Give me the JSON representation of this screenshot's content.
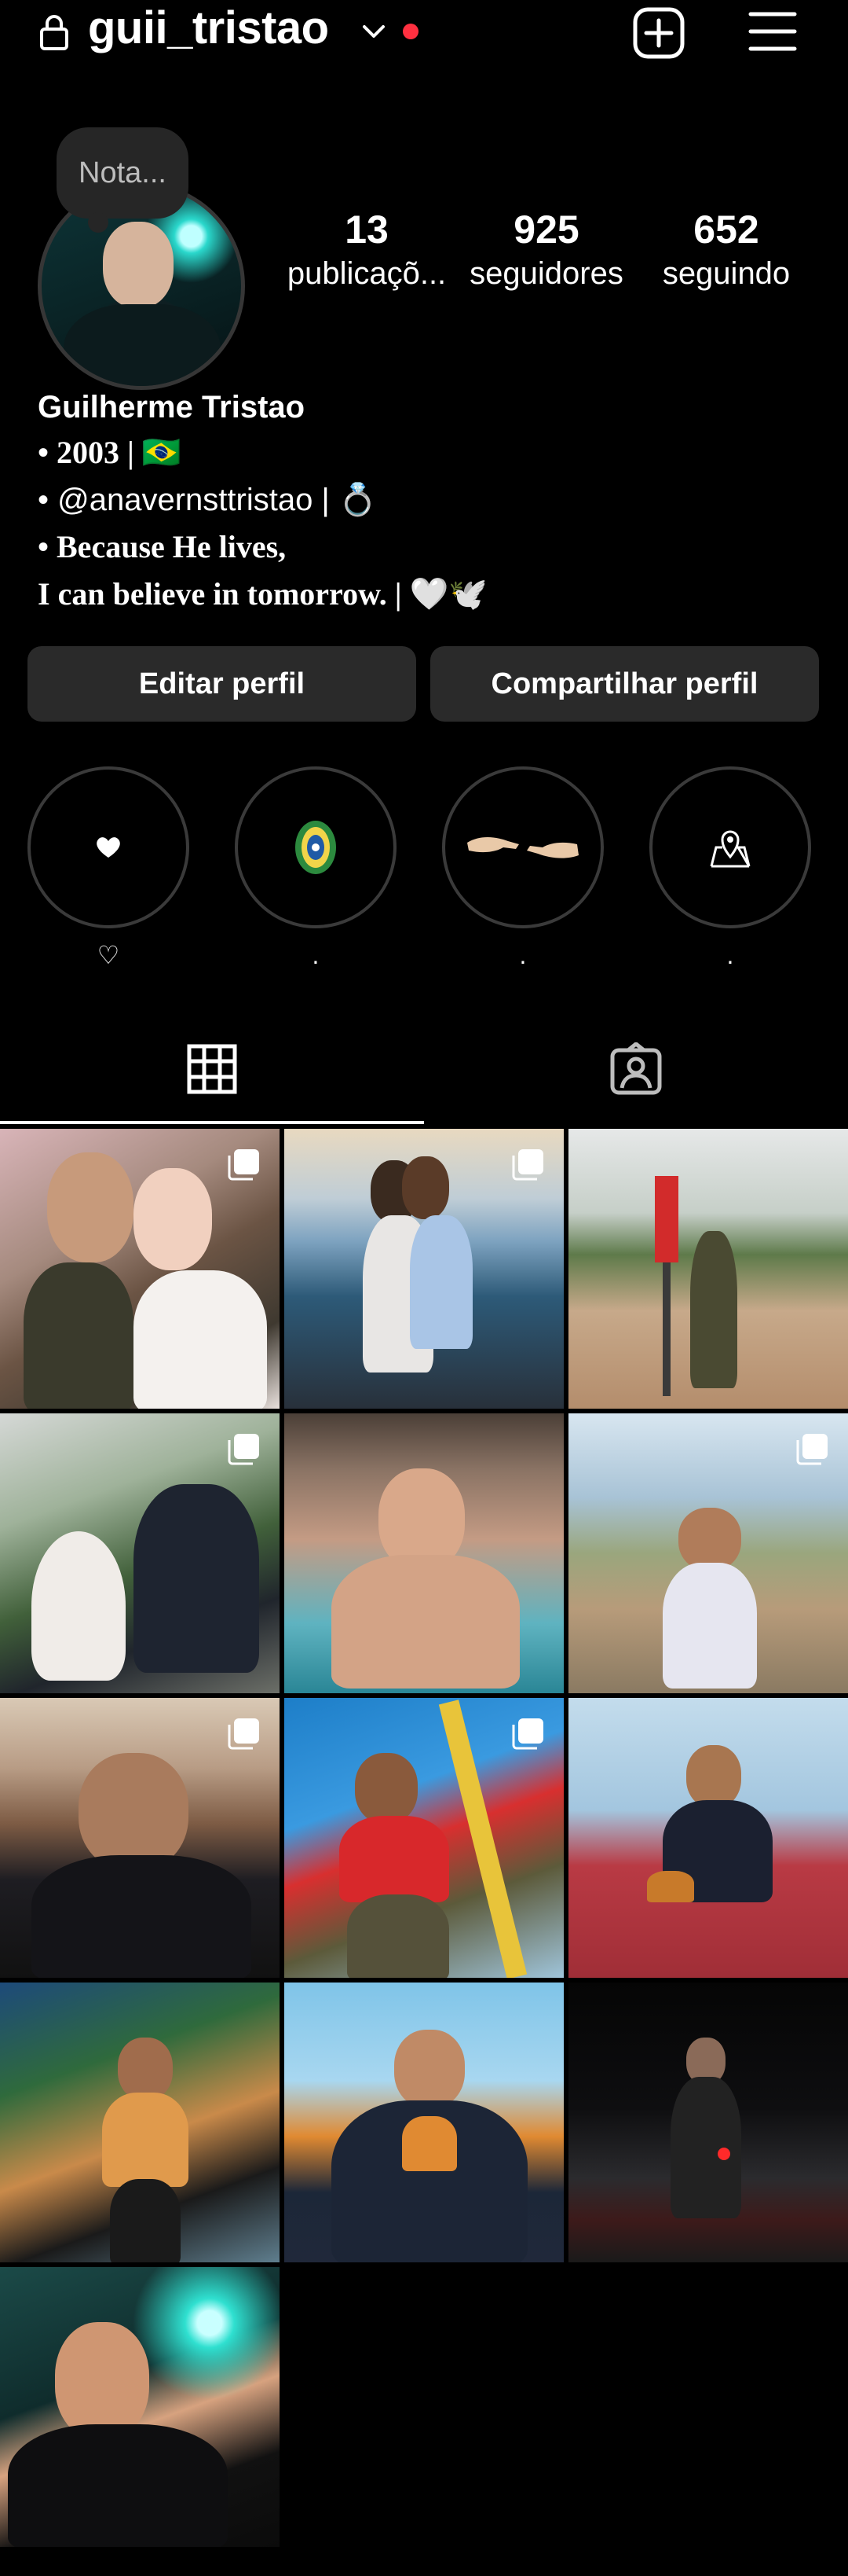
{
  "header": {
    "username": "guii_tristao",
    "lock_icon": "lock-icon",
    "dropdown_icon": "chevron-down-icon",
    "notification_dot_color": "#ff3040",
    "create_icon": "plus-square-icon",
    "menu_icon": "hamburger-menu-icon"
  },
  "profile": {
    "note": "Nota...",
    "stats": {
      "posts_count": "13",
      "posts_label": "publicaçõ...",
      "followers_count": "925",
      "followers_label": "seguidores",
      "following_count": "652",
      "following_label": "seguindo"
    },
    "bio": {
      "name": "Guilherme Tristao",
      "line1": "• 2003 | 🇧🇷",
      "line2": "• @anavernsttristao | 💍",
      "line3": "• Because He lives,",
      "line4": "I can believe in tomorrow. | 🤍🕊️"
    }
  },
  "actions": {
    "edit_label": "Editar perfil",
    "share_label": "Compartilhar perfil"
  },
  "highlights": [
    {
      "label": "♡",
      "icon": "heart-icon"
    },
    {
      "label": ".",
      "icon": "badge-emblem-icon"
    },
    {
      "label": ".",
      "icon": "hands-touching-icon"
    },
    {
      "label": ".",
      "icon": "map-pin-icon"
    }
  ],
  "tabs": [
    {
      "name": "grid",
      "icon": "grid-icon",
      "active": true
    },
    {
      "name": "tagged",
      "icon": "tagged-person-icon",
      "active": false
    }
  ],
  "posts": [
    {
      "desc": "couple-portrait",
      "multi": true
    },
    {
      "desc": "couple-kiss-lake",
      "multi": true
    },
    {
      "desc": "military-flag",
      "multi": false
    },
    {
      "desc": "man-with-dog",
      "multi": true
    },
    {
      "desc": "pool-selfie",
      "multi": false
    },
    {
      "desc": "street-portrait",
      "multi": true
    },
    {
      "desc": "hallway-portrait",
      "multi": true
    },
    {
      "desc": "red-shirt-beach",
      "multi": true
    },
    {
      "desc": "sitting-on-wall",
      "multi": false
    },
    {
      "desc": "park-night",
      "multi": false
    },
    {
      "desc": "sky-portrait",
      "multi": false
    },
    {
      "desc": "night-street",
      "multi": false
    },
    {
      "desc": "neon-portrait",
      "multi": false
    }
  ]
}
